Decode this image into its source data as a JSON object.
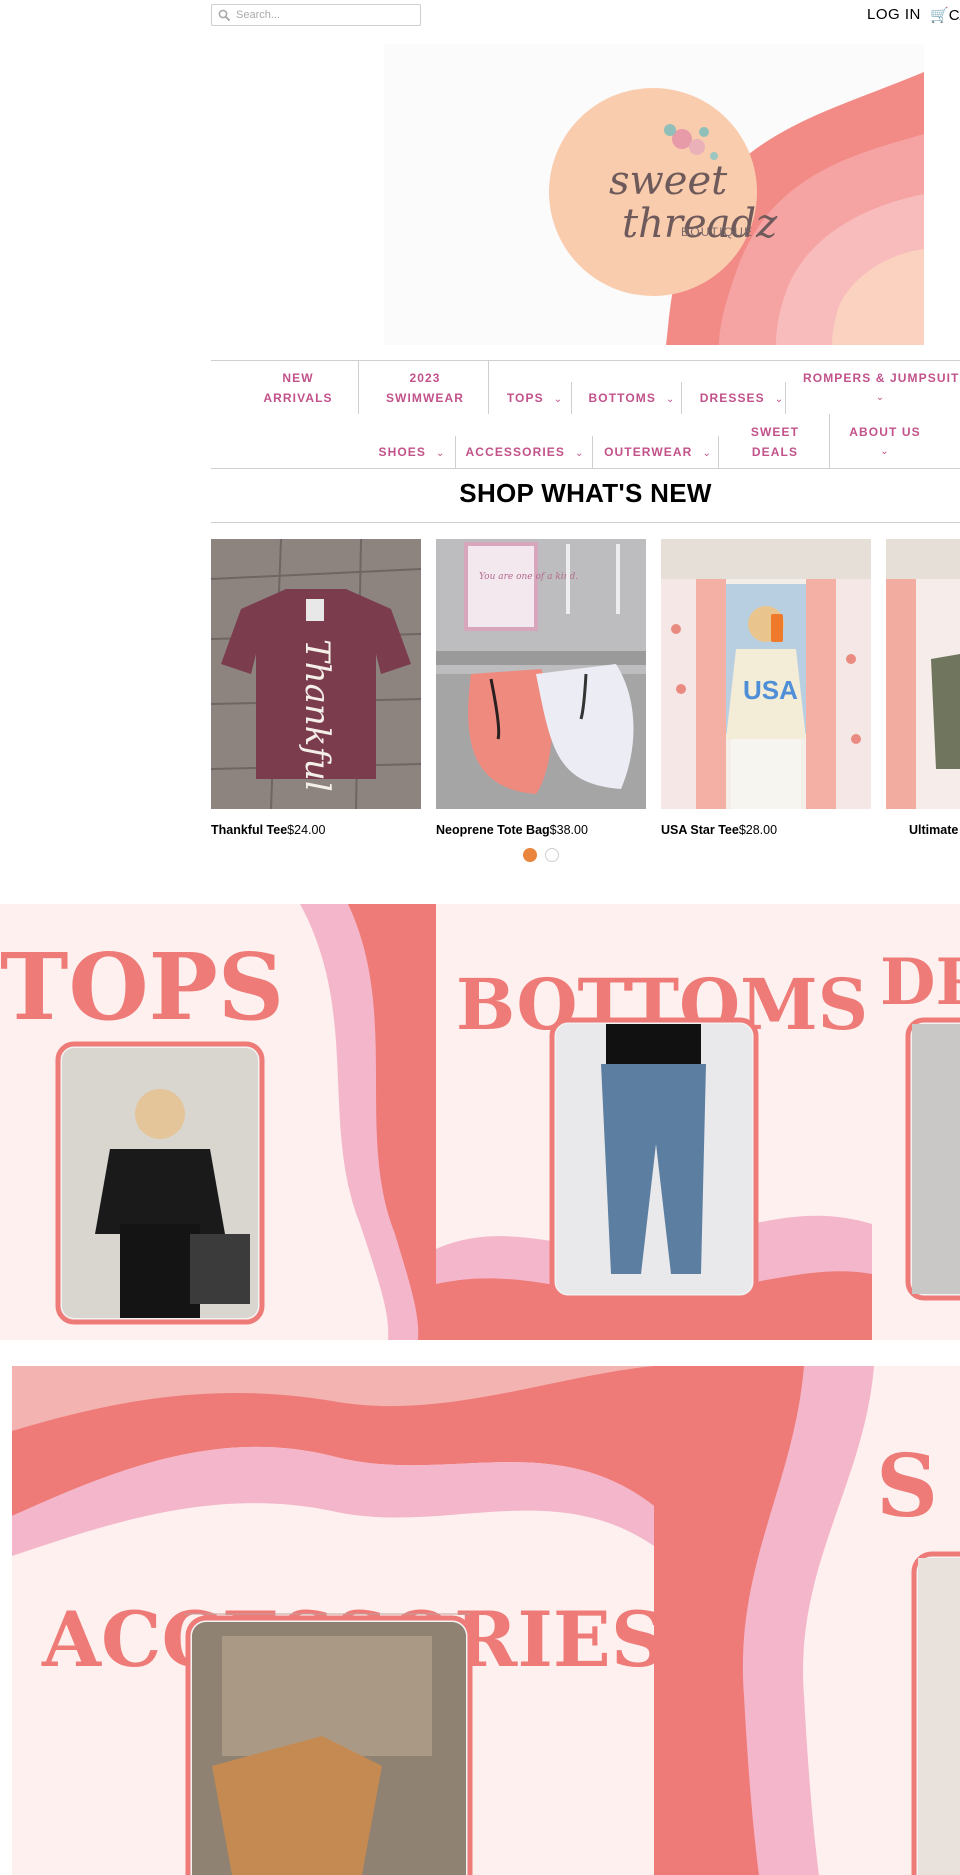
{
  "header": {
    "search_placeholder": "Search...",
    "login_label": "LOG IN",
    "cart_label": "CA"
  },
  "logo": {
    "line1": "sweet",
    "line2": "threadz",
    "line3": "BOUTIQUE"
  },
  "nav": {
    "row1": [
      {
        "label_line1": "NEW",
        "label_line2": "ARRIVALS"
      },
      {
        "label_line1": "2023",
        "label_line2": "SWIMWEAR"
      },
      {
        "label": "TOPS"
      },
      {
        "label": "BOTTOMS"
      },
      {
        "label": "DRESSES"
      },
      {
        "label": "ROMPERS & JUMPSUITS"
      }
    ],
    "row2": [
      {
        "label": "SHOES"
      },
      {
        "label": "ACCESSORIES"
      },
      {
        "label": "OUTERWEAR"
      },
      {
        "label_line1": "SWEET",
        "label_line2": "DEALS"
      },
      {
        "label": "ABOUT US"
      }
    ]
  },
  "featured": {
    "title": "SHOP WHAT'S NEW",
    "products": [
      {
        "name": "Thankful Tee",
        "price": "$24.00",
        "shirt_text": "Thankful"
      },
      {
        "name": "Neoprene Tote Bag",
        "price": "$38.00",
        "sign_text": "You are one of a kind."
      },
      {
        "name": "USA Star Tee",
        "price": "$28.00",
        "shirt_text": "USA"
      },
      {
        "name": "Ultimate C",
        "price": ""
      }
    ],
    "pagination": {
      "pages": 2,
      "active": 1
    }
  },
  "categories": {
    "row1": [
      "TOPS",
      "BOTTOMS",
      "DR"
    ],
    "row2": [
      "ACCESSORIES",
      "S"
    ]
  },
  "colors": {
    "nav_pink": "#c2528a",
    "coral": "#ee7b78",
    "light_pink": "#f4b6cb",
    "banner_bg": "#fdf0ee",
    "dot_active": "#e9853c"
  }
}
